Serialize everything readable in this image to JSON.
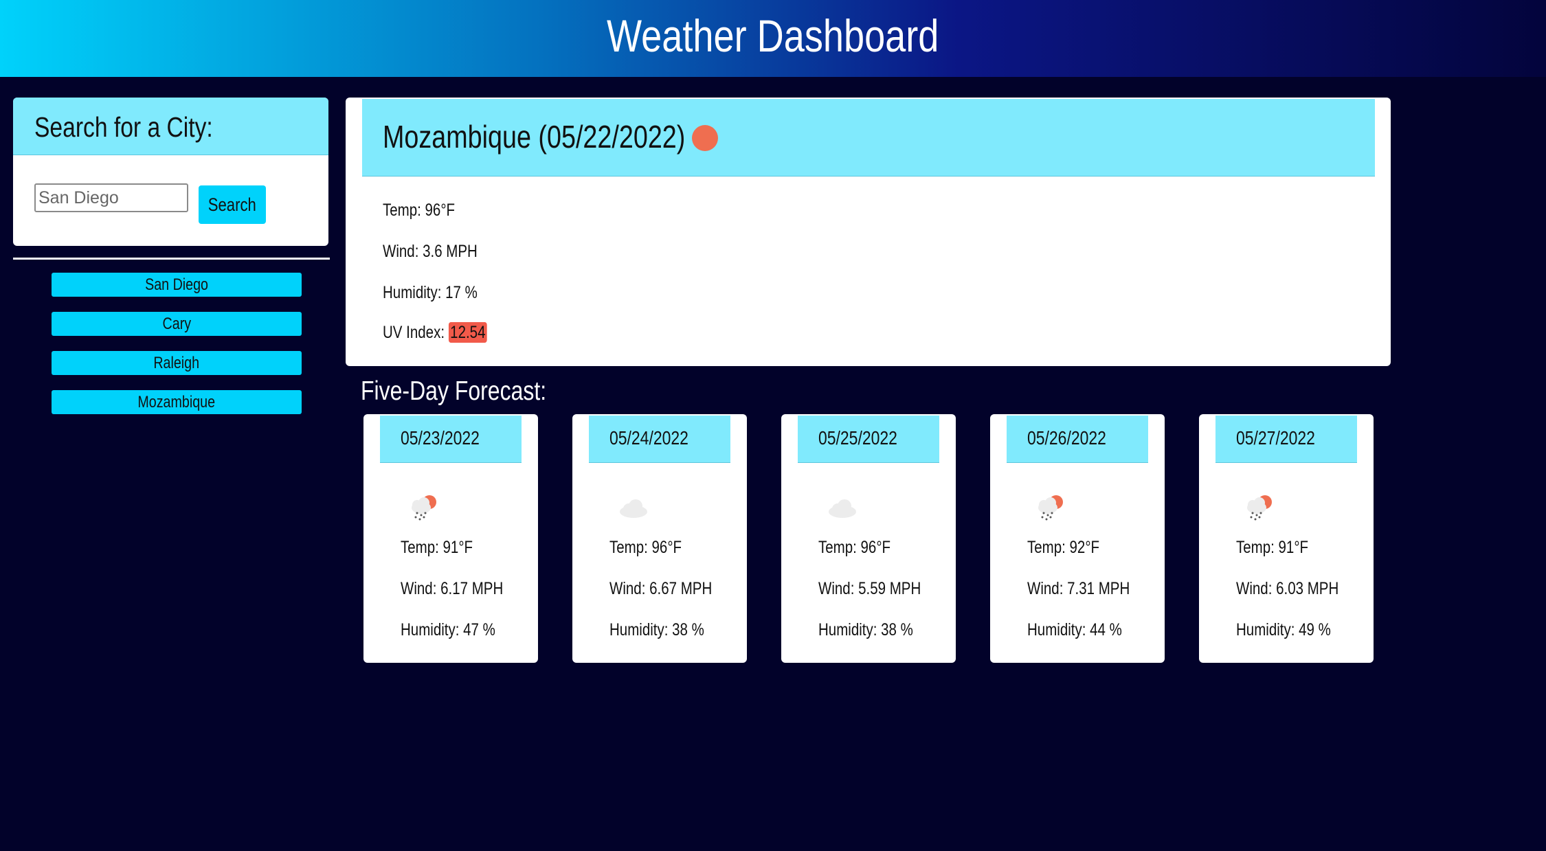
{
  "header": {
    "title": "Weather Dashboard"
  },
  "search": {
    "heading": "Search for a City:",
    "placeholder": "San Diego",
    "button_label": "Search"
  },
  "history": [
    {
      "label": "San Diego"
    },
    {
      "label": "Cary"
    },
    {
      "label": "Raleigh"
    },
    {
      "label": "Mozambique"
    }
  ],
  "current": {
    "title": "Mozambique (05/22/2022)",
    "icon": "sun-icon",
    "temp": "Temp: 96°F",
    "wind": "Wind: 3.6 MPH",
    "humidity": "Humidity: 17 %",
    "uv_label": "UV Index:",
    "uv_value": "12.54"
  },
  "forecast_title": "Five-Day Forecast:",
  "forecast": [
    {
      "date": "05/23/2022",
      "icon": "rain-sun-icon",
      "temp": "Temp: 91°F",
      "wind": "Wind: 6.17 MPH",
      "humidity": "Humidity: 47 %"
    },
    {
      "date": "05/24/2022",
      "icon": "cloud-icon",
      "temp": "Temp: 96°F",
      "wind": "Wind: 6.67 MPH",
      "humidity": "Humidity: 38 %"
    },
    {
      "date": "05/25/2022",
      "icon": "cloud-icon",
      "temp": "Temp: 96°F",
      "wind": "Wind: 5.59 MPH",
      "humidity": "Humidity: 38 %"
    },
    {
      "date": "05/26/2022",
      "icon": "rain-sun-icon",
      "temp": "Temp: 92°F",
      "wind": "Wind: 7.31 MPH",
      "humidity": "Humidity: 44 %"
    },
    {
      "date": "05/27/2022",
      "icon": "rain-sun-icon",
      "temp": "Temp: 91°F",
      "wind": "Wind: 6.03 MPH",
      "humidity": "Humidity: 49 %"
    }
  ],
  "colors": {
    "background": "#02022a",
    "accent": "#00d2fb",
    "card_header": "#80eafd",
    "uv_high": "#f15a4a",
    "sun": "#ef6e50"
  }
}
